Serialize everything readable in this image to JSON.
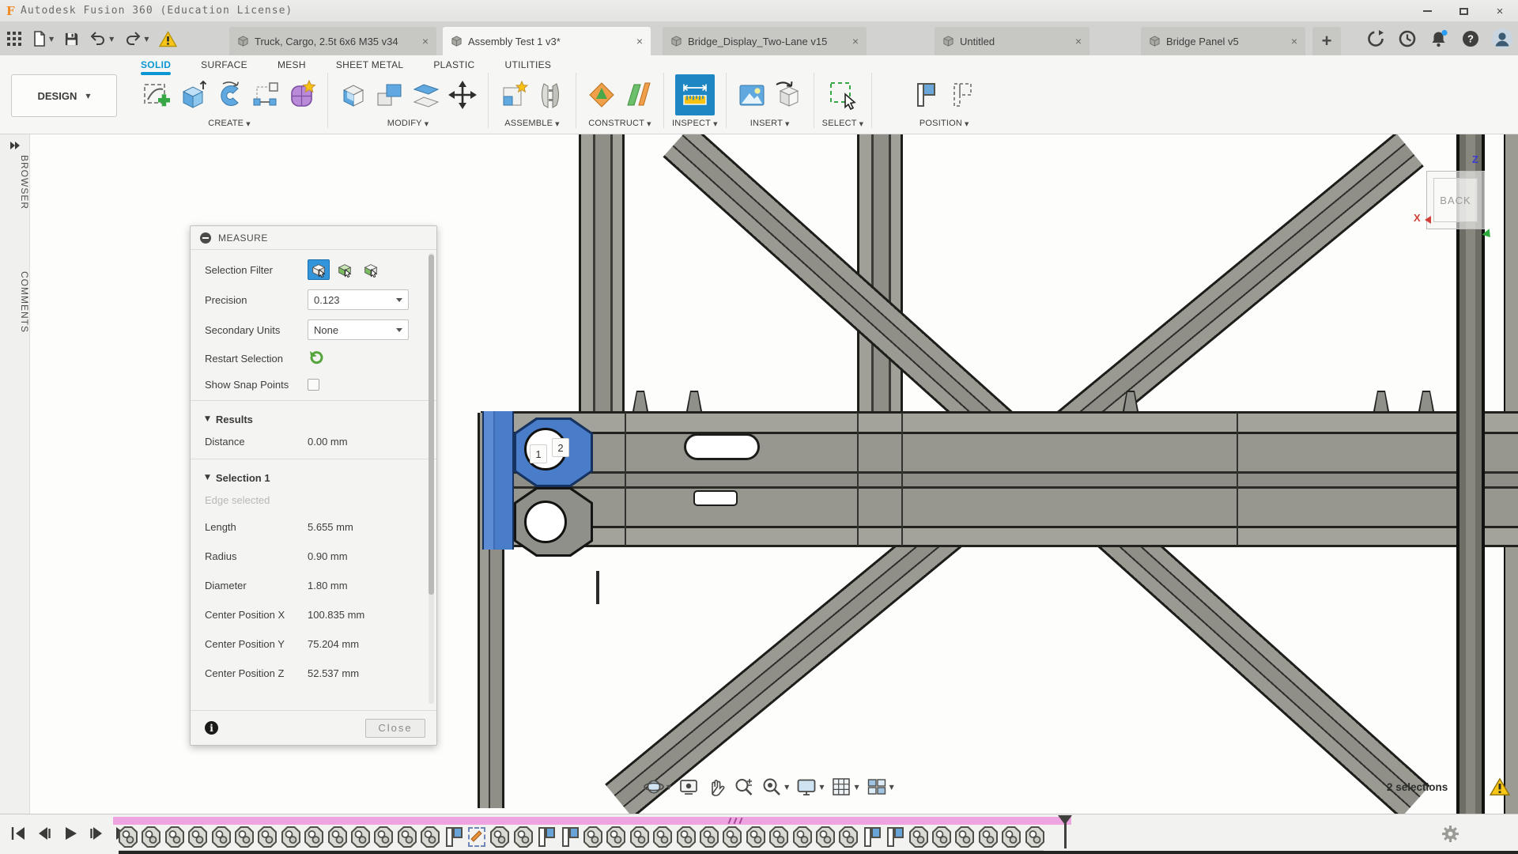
{
  "window": {
    "title": "Autodesk Fusion 360 (Education License)"
  },
  "quick_access": {
    "icons": [
      "app-grid",
      "file-new",
      "save",
      "undo",
      "redo",
      "job-status-warning"
    ]
  },
  "document_tabs": {
    "tabs": [
      {
        "label": "Truck, Cargo, 2.5t 6x6 M35 v34",
        "active": false
      },
      {
        "label": "Assembly Test 1 v3*",
        "active": true
      },
      {
        "label": "Bridge_Display_Two-Lane v15",
        "active": false
      },
      {
        "label": "Untitled",
        "active": false
      },
      {
        "label": "Bridge Panel v5",
        "active": false
      }
    ],
    "new_tab_label": "+"
  },
  "header_icons": [
    "extensions",
    "recent",
    "notifications",
    "help",
    "account"
  ],
  "ribbon": {
    "workspace_label": "DESIGN",
    "tabs": [
      {
        "label": "SOLID",
        "active": true
      },
      {
        "label": "SURFACE",
        "active": false
      },
      {
        "label": "MESH",
        "active": false
      },
      {
        "label": "SHEET METAL",
        "active": false
      },
      {
        "label": "PLASTIC",
        "active": false
      },
      {
        "label": "UTILITIES",
        "active": false
      }
    ],
    "groups": [
      {
        "label": "CREATE",
        "icons": [
          "create-sketch",
          "extrude",
          "revolve",
          "sketch-dimension",
          "create-form"
        ]
      },
      {
        "label": "MODIFY",
        "icons": [
          "press-pull",
          "combine",
          "split-body",
          "move-copy"
        ]
      },
      {
        "label": "ASSEMBLE",
        "icons": [
          "new-component",
          "joint"
        ]
      },
      {
        "label": "CONSTRUCT",
        "icons": [
          "offset-plane",
          "plane-at-angle"
        ]
      },
      {
        "label": "INSPECT",
        "icons": [
          "measure"
        ],
        "active_icon": "measure"
      },
      {
        "label": "INSERT",
        "icons": [
          "canvas",
          "insert-derive"
        ]
      },
      {
        "label": "SELECT",
        "icons": [
          "select"
        ]
      },
      {
        "label": "POSITION",
        "icons": [
          "capture-position",
          "revert-position"
        ]
      }
    ]
  },
  "side_rail": {
    "browser_label": "BROWSER",
    "comments_label": "COMMENTS"
  },
  "measure": {
    "title": "MEASURE",
    "fields": {
      "selection_filter_label": "Selection Filter",
      "selection_filter_icons": [
        "filter-edge",
        "filter-body",
        "filter-component"
      ],
      "precision_label": "Precision",
      "precision_value": "0.123",
      "secondary_units_label": "Secondary Units",
      "secondary_units_value": "None",
      "restart_selection_label": "Restart Selection",
      "show_snap_points_label": "Show Snap Points",
      "show_snap_points_checked": false
    },
    "results": {
      "header": "Results",
      "rows": [
        {
          "label": "Distance",
          "value": "0.00 mm"
        }
      ]
    },
    "selection1": {
      "header": "Selection 1",
      "note": "Edge selected",
      "rows": [
        {
          "label": "Length",
          "value": "5.655 mm"
        },
        {
          "label": "Radius",
          "value": "0.90 mm"
        },
        {
          "label": "Diameter",
          "value": "1.80 mm"
        },
        {
          "label": "Center Position X",
          "value": "100.835 mm"
        },
        {
          "label": "Center Position Y",
          "value": "75.204 mm"
        },
        {
          "label": "Center Position Z",
          "value": "52.537 mm"
        }
      ]
    },
    "close_label": "Close"
  },
  "viewport": {
    "viewcube_face": "BACK",
    "axis_labels": {
      "x": "X",
      "z": "Z"
    },
    "selection_point_labels": [
      "1",
      "2"
    ],
    "status": "2 selections",
    "nav_icons": [
      {
        "name": "orbit",
        "caret": true
      },
      {
        "name": "look-at",
        "caret": false
      },
      {
        "name": "pan",
        "caret": false
      },
      {
        "name": "zoom",
        "caret": false
      },
      {
        "name": "fit-view",
        "caret": true
      },
      {
        "name": "display-settings",
        "caret": true
      },
      {
        "name": "grid-snap",
        "caret": true
      },
      {
        "name": "viewports",
        "caret": true
      }
    ]
  },
  "timeline": {
    "playback_icons": [
      "go-to-start",
      "step-back",
      "play",
      "step-forward",
      "go-to-end"
    ],
    "items": [
      "joint",
      "joint",
      "joint",
      "joint",
      "joint",
      "joint",
      "joint",
      "joint",
      "joint",
      "joint",
      "joint",
      "joint",
      "joint",
      "joint",
      "flag",
      "sketch",
      "joint",
      "joint",
      "flag",
      "flag",
      "joint",
      "joint",
      "joint",
      "joint",
      "joint",
      "joint",
      "joint",
      "joint",
      "joint",
      "joint",
      "joint",
      "joint",
      "flag",
      "flag",
      "joint",
      "joint",
      "joint",
      "joint",
      "joint",
      "joint"
    ]
  },
  "colors": {
    "accent_blue": "#0a96d2",
    "selection_blue": "#4a7dc9",
    "timeline_pink": "#eda4e0",
    "warning_yellow": "#f8c617"
  }
}
